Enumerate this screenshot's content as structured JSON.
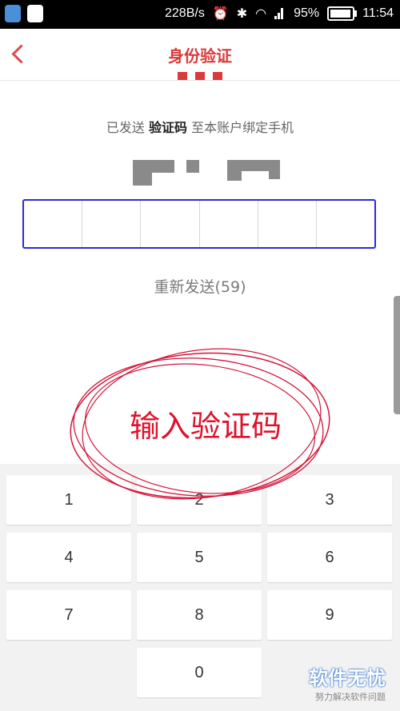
{
  "status_bar": {
    "speed": "228B/s",
    "battery": "95%",
    "battery_level": 0.95,
    "time": "11:54",
    "icons": [
      "shield-app-icon",
      "qq-app-icon",
      "alarm-icon",
      "bluetooth-icon",
      "wifi-icon",
      "signal-icon",
      "battery-icon"
    ]
  },
  "header": {
    "title": "身份验证",
    "back_icon": "chevron-left-icon",
    "accent_color": "#d93a3a"
  },
  "message": {
    "prefix": "已发送 ",
    "highlight": "验证码",
    "suffix": " 至本账户绑定手机"
  },
  "code_input": {
    "cells": [
      "",
      "",
      "",
      "",
      "",
      ""
    ],
    "border_color": "#2b2bd6"
  },
  "resend": {
    "label": "重新发送(59)"
  },
  "annotation": {
    "text": "输入验证码",
    "color": "#e0112a"
  },
  "keypad": {
    "keys": [
      "1",
      "2",
      "3",
      "4",
      "5",
      "6",
      "7",
      "8",
      "9",
      "0"
    ]
  },
  "watermark": {
    "main": "软件无忧",
    "sub": "努力解决软件问题"
  }
}
